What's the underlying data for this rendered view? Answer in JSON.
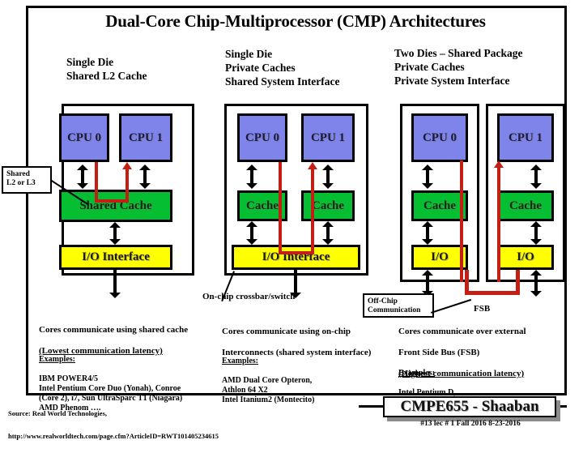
{
  "slide": {
    "title": "Dual-Core Chip-Multiprocessor (CMP) Architectures"
  },
  "panels": [
    {
      "id": "single-die-shared-l2",
      "header": "Single Die\nShared L2 Cache",
      "blocks": {
        "cpu0": "CPU 0",
        "cpu1": "CPU 1",
        "cache": "Shared Cache",
        "io": "I/O Interface"
      },
      "callout": "Shared\nL2 or L3",
      "note_line1": "Cores communicate using shared cache",
      "note_line2": "(Lowest communication latency)",
      "examples_heading": "Examples:",
      "examples": "IBM POWER4/5\nIntel Pentium Core Duo (Yonah), Conroe\n(Core 2), i7, Sun UltraSparc T1  (Niagara)\nAMD Phenom …."
    },
    {
      "id": "single-die-private-caches",
      "header": "Single Die\nPrivate Caches\nShared System Interface",
      "blocks": {
        "cpu0": "CPU 0",
        "cpu1": "CPU 1",
        "cache0": "Cache",
        "cache1": "Cache",
        "io": "I/O Interface"
      },
      "pointer_label": "On-chip crossbar/switch",
      "note_line1": "Cores communicate using on-chip",
      "note_line2": "Interconnects (shared system interface)",
      "examples_heading": "Examples:",
      "examples": "AMD  Dual Core Opteron,\n         Athlon 64 X2\nIntel Itanium2 (Montecito)"
    },
    {
      "id": "two-dies-shared-package",
      "header": "Two Dies – Shared Package\nPrivate Caches\nPrivate System Interface",
      "blocks": {
        "cpu0": "CPU 0",
        "cpu1": "CPU 1",
        "cache0": "Cache",
        "cache1": "Cache",
        "io0": "I/O",
        "io1": "I/O"
      },
      "callout": "Off-Chip\nCommunication",
      "bus_label": "FSB",
      "note_line1": "Cores communicate over external",
      "note_line2": "Front Side Bus (FSB)",
      "note_line3": "(Highest communication latency)",
      "examples_heading": "Examples:",
      "examples": "Intel Pentium D,\nIntel Quad core (two dual-core chips)"
    }
  ],
  "source": {
    "line1": "Source: Real World Technologies,",
    "line2": "http://www.realworldtech.com/page.cfm?ArticleID=RWT101405234615"
  },
  "footer": {
    "badge": "CMPE655 - Shaaban",
    "meta": "#13  lec # 1   Fall 2016   8-23-2016"
  },
  "colors": {
    "cpu": "#7f84ea",
    "cache": "#06be32",
    "io": "#ffff00",
    "connector": "#c31f14",
    "frame": "#000000"
  }
}
